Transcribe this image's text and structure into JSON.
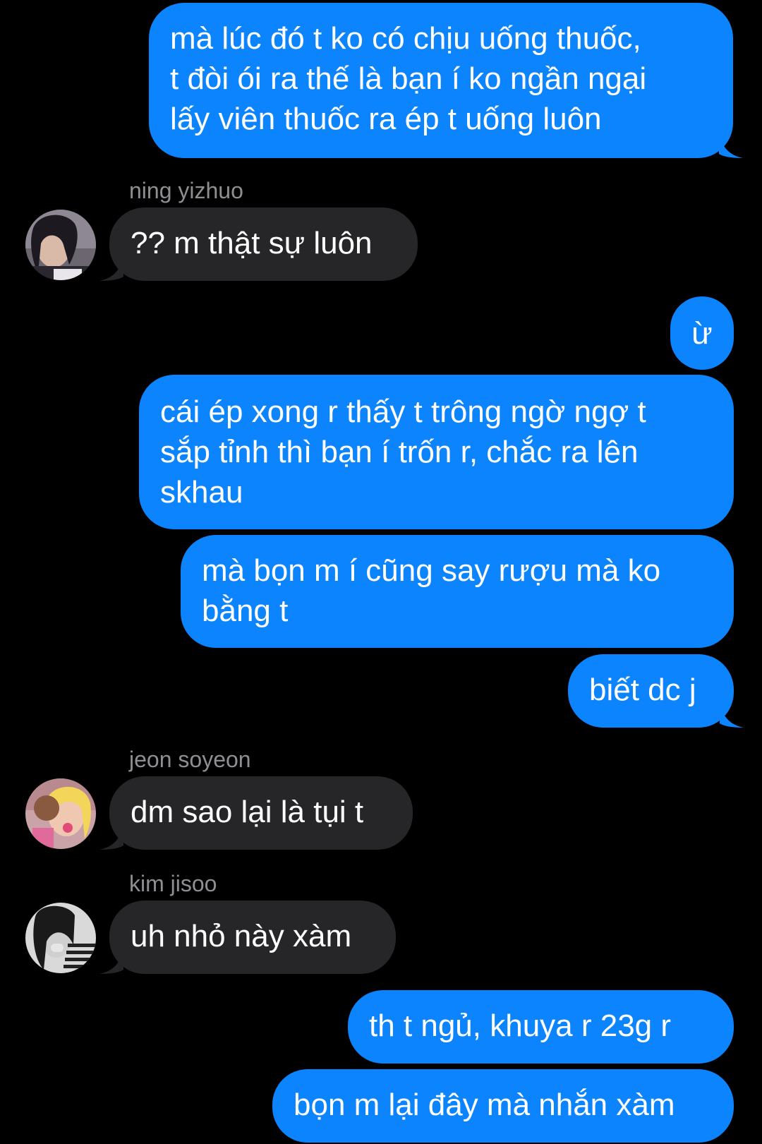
{
  "messages": [
    {
      "side": "sent",
      "text": "mà lúc đó t ko có chịu uống thuốc,\nt đòi ói ra thế là bạn í ko ngần ngại\nlấy viên thuốc ra ép t uống luôn"
    },
    {
      "side": "received",
      "sender": "ning yizhuo",
      "text": "?? m thật sự luôn",
      "avatar": "avatar-ning-yizhuo"
    },
    {
      "side": "sent",
      "text": "ừ"
    },
    {
      "side": "sent",
      "text": "cái ép xong r thấy t trông ngờ ngợ t\nsắp tỉnh thì bạn í trốn r, chắc ra lên\nskhau"
    },
    {
      "side": "sent",
      "text": "mà bọn m í cũng say rượu mà ko\nbằng t"
    },
    {
      "side": "sent",
      "text": "biết dc j"
    },
    {
      "side": "received",
      "sender": "jeon soyeon",
      "text": "dm sao lại là tụi t",
      "avatar": "avatar-jeon-soyeon"
    },
    {
      "side": "received",
      "sender": "kim jisoo",
      "text": "uh nhỏ này xàm",
      "avatar": "avatar-kim-jisoo"
    },
    {
      "side": "sent",
      "text": "th t ngủ, khuya r 23g r"
    },
    {
      "side": "sent",
      "text": "bọn m lại đây mà nhắn xàm"
    }
  ],
  "colors": {
    "background": "#000000",
    "sent_bubble": "#0B84FE",
    "received_bubble": "#262628",
    "sender_name": "#8E8E93",
    "text": "#FFFFFF"
  }
}
